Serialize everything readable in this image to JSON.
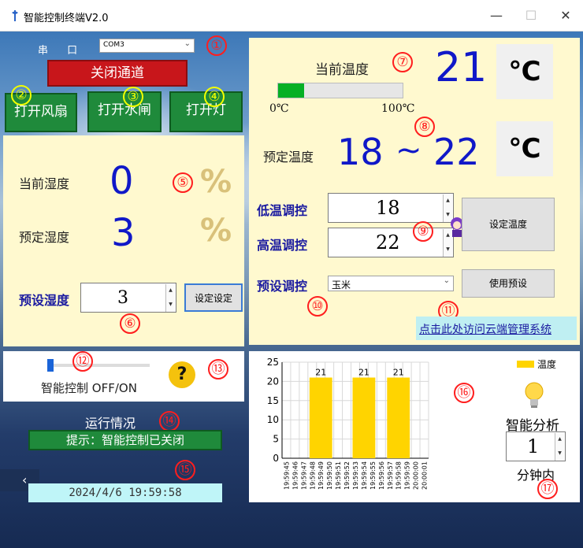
{
  "window": {
    "title": "智能控制终端V2.0",
    "minimize": "—",
    "maximize": "☐",
    "close": "✕"
  },
  "serial": {
    "label": "串 口",
    "port": "COM3",
    "close_channel_button": "关闭通道"
  },
  "device_buttons": {
    "fan": "打开风扇",
    "water_gate": "打开水闸",
    "light": "打开灯"
  },
  "humidity": {
    "current_label": "当前湿度",
    "current_value": "0",
    "current_unit": "%",
    "preset_label": "预定湿度",
    "preset_value": "3",
    "preset_unit": "%",
    "set_label": "预设湿度",
    "set_value": "3",
    "set_button": "设定设定"
  },
  "temperature": {
    "current_label": "当前温度",
    "current_value": "21",
    "unit": "℃",
    "progress_min_label": "0℃",
    "progress_max_label": "100℃",
    "progress_fraction": 0.21,
    "preset_label": "预定温度",
    "preset_low": "18",
    "preset_tilde": "~",
    "preset_high": "22",
    "low_label": "低温调控",
    "low_value": "18",
    "high_label": "高温调控",
    "high_value": "22",
    "set_button": "设定温度",
    "preset_mode_label": "预设调控",
    "preset_mode_value": "玉米",
    "use_preset_button": "使用预设",
    "cloud_link": "点击此处访问云端管理系统"
  },
  "smart_control": {
    "label": "智能控制 OFF/ON",
    "help": "?",
    "slider_fraction": 0.0
  },
  "status": {
    "title": "运行情况",
    "message": "提示：智能控制已关闭",
    "datetime": "2024/4/6 19:59:58",
    "collapse": "‹"
  },
  "analysis": {
    "legend": "温度",
    "title": "智能分析",
    "minutes_value": "1",
    "minutes_label": "分钟内"
  },
  "markers": [
    "①",
    "②",
    "③",
    "④",
    "⑤",
    "⑥",
    "⑦",
    "⑧",
    "⑨",
    "⑩",
    "⑪",
    "⑫",
    "⑬",
    "⑭",
    "⑮",
    "⑯",
    "⑰"
  ],
  "chart_data": {
    "type": "bar",
    "categories": [
      "19:59:45",
      "19:59:46",
      "19:59:47",
      "19:59:48",
      "19:59:49",
      "19:59:50",
      "19:59:51",
      "19:59:52",
      "19:59:53",
      "19:59:54",
      "19:59:55",
      "19:59:56",
      "19:59:57",
      "19:59:58",
      "19:59:59",
      "20:00:00",
      "20:00:01"
    ],
    "series": [
      {
        "name": "温度",
        "values": [
          null,
          null,
          null,
          21,
          21,
          21,
          null,
          null,
          21,
          21,
          21,
          null,
          21,
          21,
          21,
          null,
          null
        ]
      }
    ],
    "bar_labels": [
      "21",
      "21",
      "21"
    ],
    "bar_groups": [
      [
        3,
        5
      ],
      [
        8,
        10
      ],
      [
        12,
        14
      ]
    ],
    "ylim": [
      0,
      25
    ],
    "yticks": [
      "0",
      "5",
      "10",
      "15",
      "20",
      "25"
    ],
    "grid": true,
    "legend_position": "top-right",
    "bar_color": "#ffd400"
  }
}
